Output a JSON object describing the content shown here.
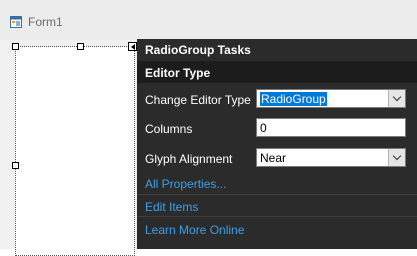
{
  "window": {
    "title": "Form1"
  },
  "panel": {
    "title": "RadioGroup Tasks",
    "section": "Editor Type",
    "rows": {
      "editor_type": {
        "label": "Change Editor Type",
        "value": "RadioGroup"
      },
      "columns": {
        "label": "Columns",
        "value": "0"
      },
      "glyph_alignment": {
        "label": "Glyph Alignment",
        "value": "Near"
      }
    },
    "links": {
      "all_properties": "All Properties...",
      "edit_items": "Edit Items",
      "learn_more": "Learn More Online"
    }
  },
  "colors": {
    "panel_bg": "#2b2b2b",
    "link": "#3c9fe8",
    "selection": "#0078d7"
  },
  "icons": [
    "form-icon",
    "smart-tag-arrow-icon",
    "chevron-down-icon"
  ]
}
